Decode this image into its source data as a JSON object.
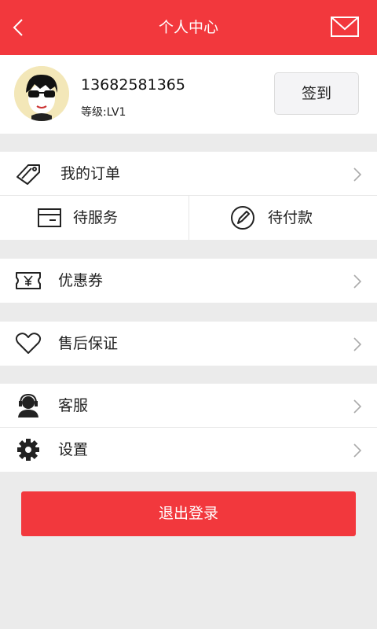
{
  "header": {
    "title": "个人中心",
    "back_icon": "back-arrow-icon",
    "mail_icon": "mail-icon"
  },
  "profile": {
    "phone": "13682581365",
    "level": "等级:LV1",
    "checkin_label": "签到"
  },
  "orders": {
    "label": "我的订单",
    "sub": [
      {
        "label": "待服务",
        "icon": "box-icon"
      },
      {
        "label": "待付款",
        "icon": "pen-circle-icon"
      }
    ]
  },
  "menu": {
    "coupon": "优惠券",
    "aftersale": "售后保证",
    "service": "客服",
    "settings": "设置"
  },
  "logout_label": "退出登录",
  "colors": {
    "accent": "#f2383d",
    "background": "#ebebeb"
  }
}
